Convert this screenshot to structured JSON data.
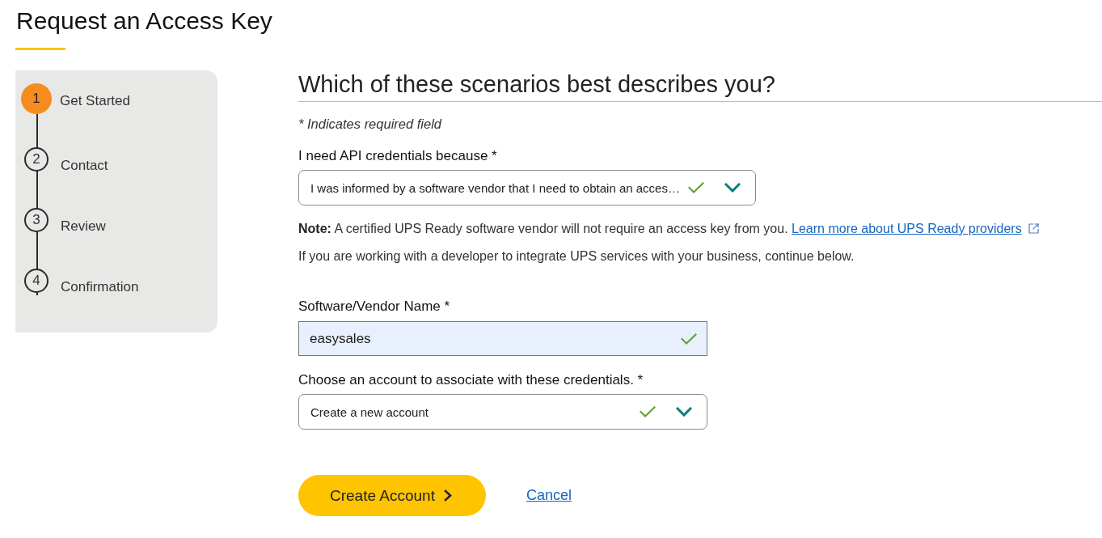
{
  "page": {
    "title": "Request an Access Key"
  },
  "steps": [
    {
      "number": "1",
      "label": "Get Started",
      "selected": true
    },
    {
      "number": "2",
      "label": "Contact",
      "selected": false
    },
    {
      "number": "3",
      "label": "Review",
      "selected": false
    },
    {
      "number": "4",
      "label": "Confirmation",
      "selected": false
    }
  ],
  "form": {
    "heading": "Which of these scenarios best describes you?",
    "required_note": "* Indicates required field",
    "items": [
      {
        "kind": "select",
        "label": "I need API credentials because *",
        "value": "I was informed by a software vendor that I need to obtain an acces…",
        "valid": true
      },
      {
        "kind": "note",
        "text": "**Note:** A certified UPS Ready software vendor will not require an access key from you.",
        "link": "Learn more about UPS Ready providers",
        "external": true
      },
      {
        "kind": "paragraph",
        "text": "If you are working with a developer to integrate UPS services with your business, continue below."
      },
      {
        "kind": "input",
        "label": "Software/Vendor Name *",
        "value": "easysales",
        "valid": true
      },
      {
        "kind": "select",
        "label": "Choose an account to associate with these credentials. *",
        "value": "Create a new account",
        "valid": true
      }
    ],
    "actions": [
      {
        "kind": "primary",
        "label": "Create Account"
      },
      {
        "kind": "link",
        "label": "Cancel"
      }
    ]
  }
}
